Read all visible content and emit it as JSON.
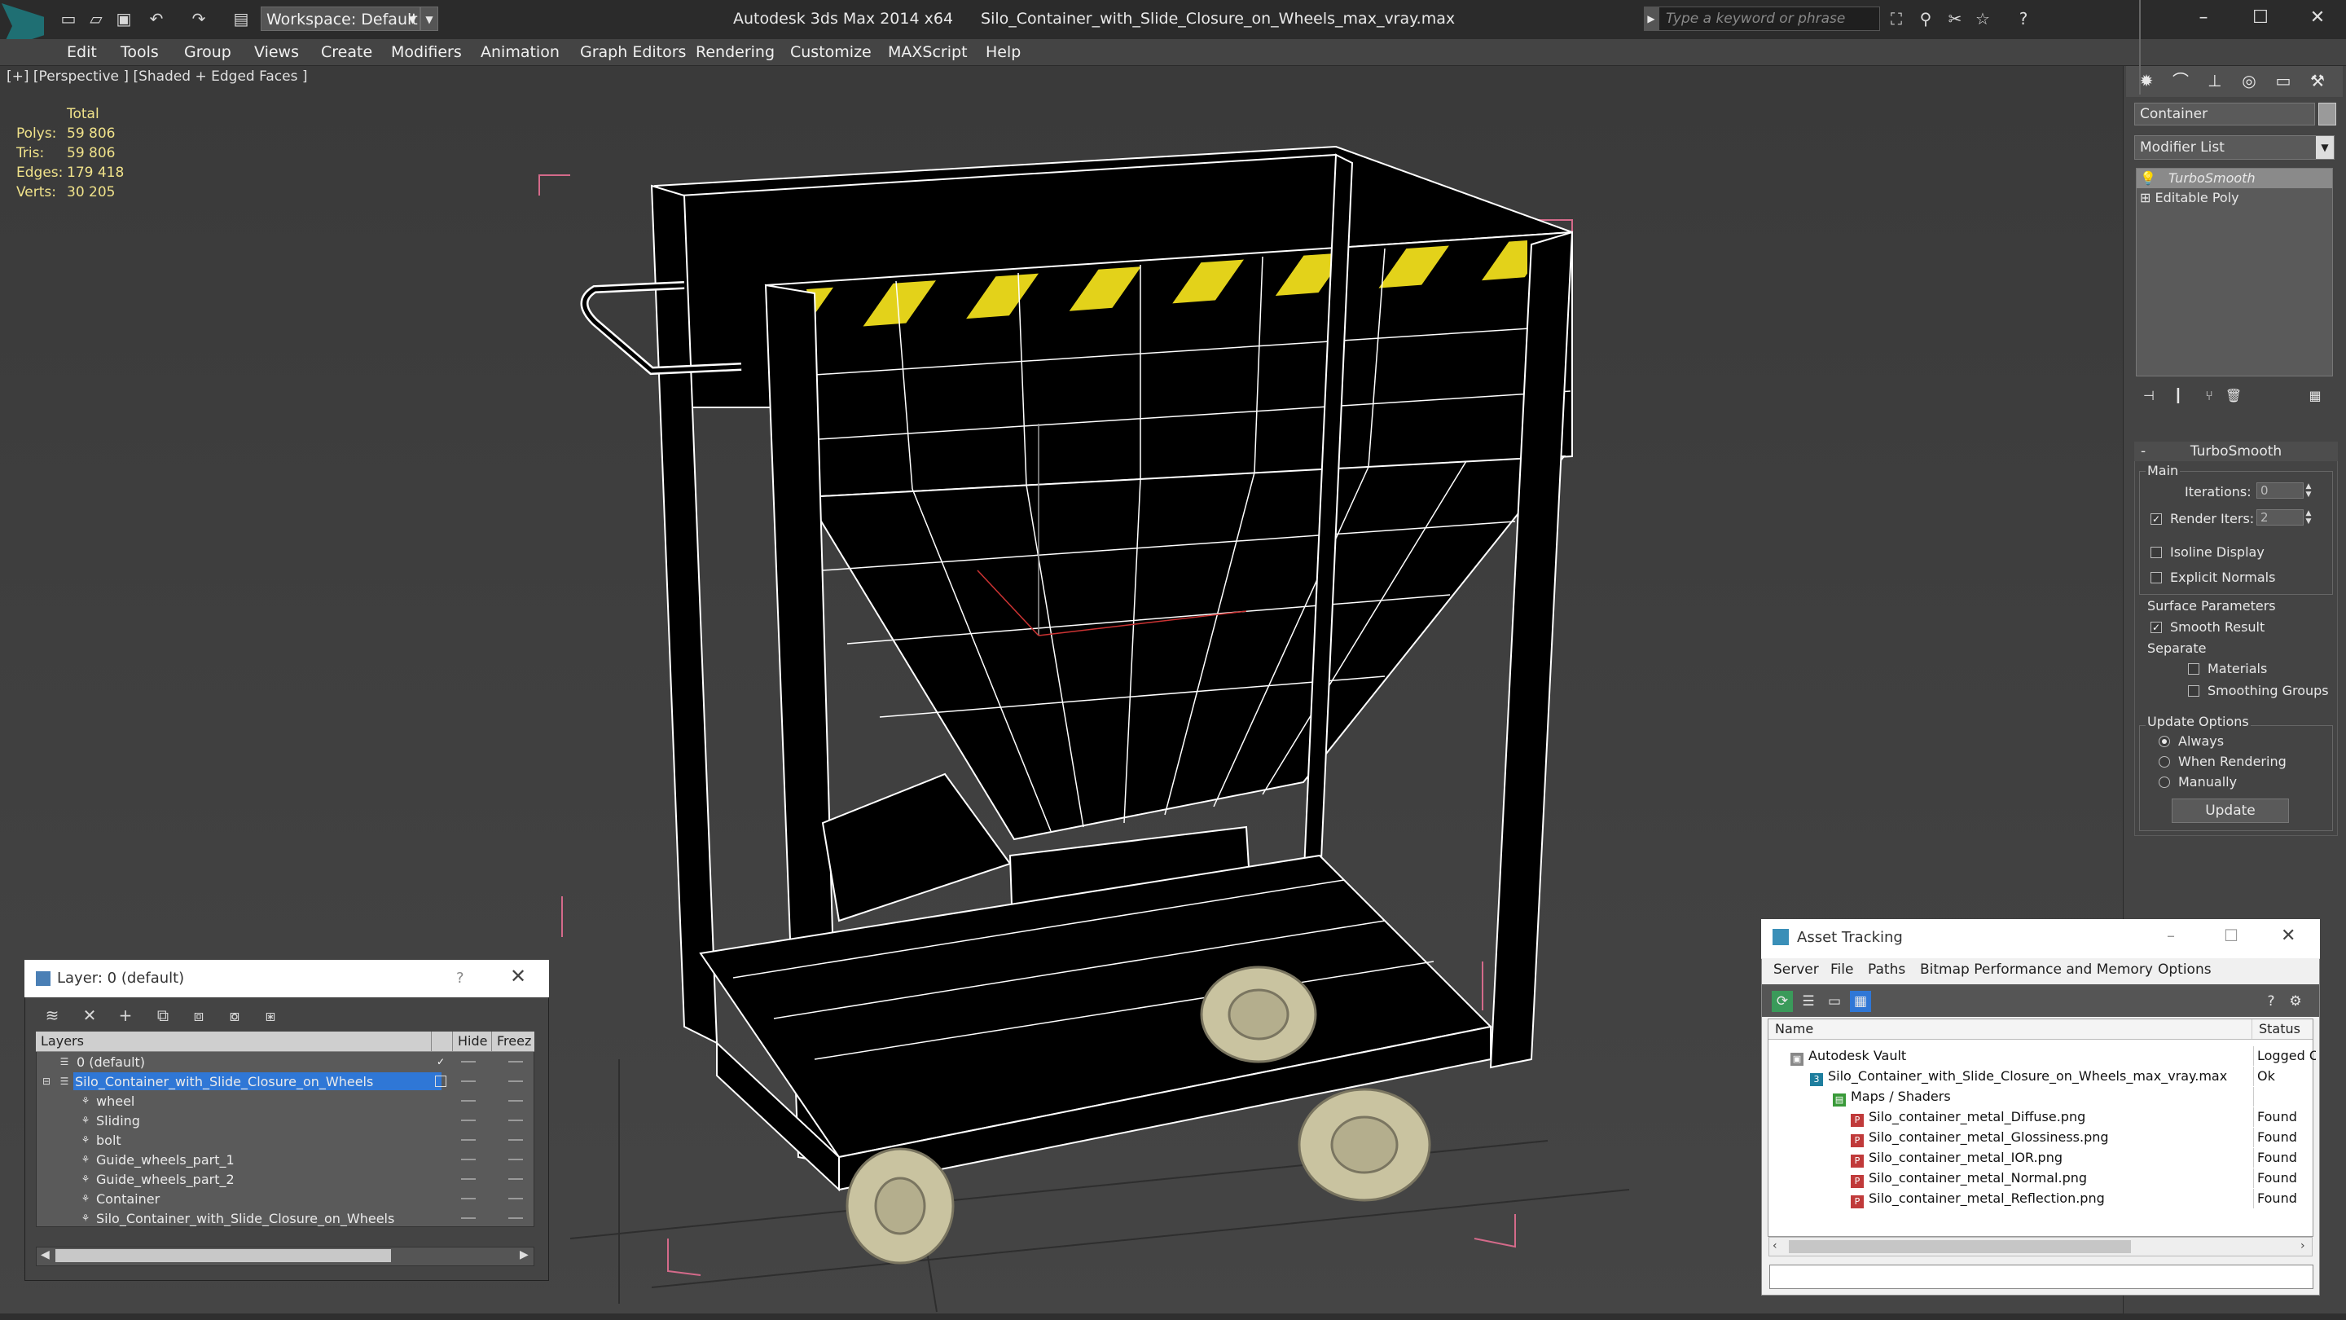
{
  "titlebar": {
    "workspace": "Workspace: Default",
    "app_name": "Autodesk 3ds Max  2014 x64",
    "file_name": "Silo_Container_with_Slide_Closure_on_Wheels_max_vray.max",
    "search_placeholder": "Type a keyword or phrase"
  },
  "menu": [
    "Edit",
    "Tools",
    "Group",
    "Views",
    "Create",
    "Modifiers",
    "Animation",
    "Graph Editors",
    "Rendering",
    "Customize",
    "MAXScript",
    "Help"
  ],
  "viewport": {
    "label": "[+] [Perspective ] [Shaded + Edged Faces ]",
    "stats": {
      "header": "Total",
      "rows": [
        {
          "label": "Polys:",
          "value": "59 806"
        },
        {
          "label": "Tris:",
          "value": "59 806"
        },
        {
          "label": "Edges:",
          "value": "179 418"
        },
        {
          "label": "Verts:",
          "value": "30 205"
        }
      ]
    },
    "colors": {
      "stripe_yellow": "#e3d21a",
      "box_pink": "#d46a8a",
      "mesh_fill": "#000000",
      "wire": "#ffffff",
      "wheel": "#c9c3a0"
    }
  },
  "command_panel": {
    "object_name": "Container",
    "modifier_list": "Modifier List",
    "stack": [
      "TurboSmooth",
      "Editable Poly"
    ],
    "rollout_title": "TurboSmooth",
    "main_group": "Main",
    "iterations_label": "Iterations:",
    "iterations_value": "0",
    "render_iters_label": "Render Iters:",
    "render_iters_value": "2",
    "isoline": "Isoline Display",
    "explicit_normals": "Explicit Normals",
    "surface_group": "Surface Parameters",
    "smooth_result": "Smooth Result",
    "separate": "Separate",
    "materials": "Materials",
    "smoothing_groups": "Smoothing Groups",
    "update_group": "Update Options",
    "always": "Always",
    "when_rendering": "When Rendering",
    "manually": "Manually",
    "update_button": "Update"
  },
  "layer_dialog": {
    "title": "Layer: 0 (default)",
    "help": "?",
    "columns": [
      "Layers",
      "Hide",
      "Freez"
    ],
    "rows": [
      {
        "name": "0 (default)"
      },
      {
        "name": "Silo_Container_with_Slide_Closure_on_Wheels"
      },
      {
        "name": "wheel"
      },
      {
        "name": "Sliding"
      },
      {
        "name": "bolt"
      },
      {
        "name": "Guide_wheels_part_1"
      },
      {
        "name": "Guide_wheels_part_2"
      },
      {
        "name": "Container"
      },
      {
        "name": "Silo_Container_with_Slide_Closure_on_Wheels"
      }
    ]
  },
  "asset_tracking": {
    "title": "Asset Tracking",
    "menu": [
      "Server",
      "File",
      "Paths",
      "Bitmap Performance and Memory",
      "Options"
    ],
    "columns": [
      "Name",
      "Status"
    ],
    "rows": [
      {
        "name": "Autodesk Vault",
        "status": "Logged O"
      },
      {
        "name": "Silo_Container_with_Slide_Closure_on_Wheels_max_vray.max",
        "status": "Ok"
      },
      {
        "name": "Maps / Shaders",
        "status": ""
      },
      {
        "name": "Silo_container_metal_Diffuse.png",
        "status": "Found"
      },
      {
        "name": "Silo_container_metal_Glossiness.png",
        "status": "Found"
      },
      {
        "name": "Silo_container_metal_IOR.png",
        "status": "Found"
      },
      {
        "name": "Silo_container_metal_Normal.png",
        "status": "Found"
      },
      {
        "name": "Silo_container_metal_Reflection.png",
        "status": "Found"
      }
    ]
  }
}
